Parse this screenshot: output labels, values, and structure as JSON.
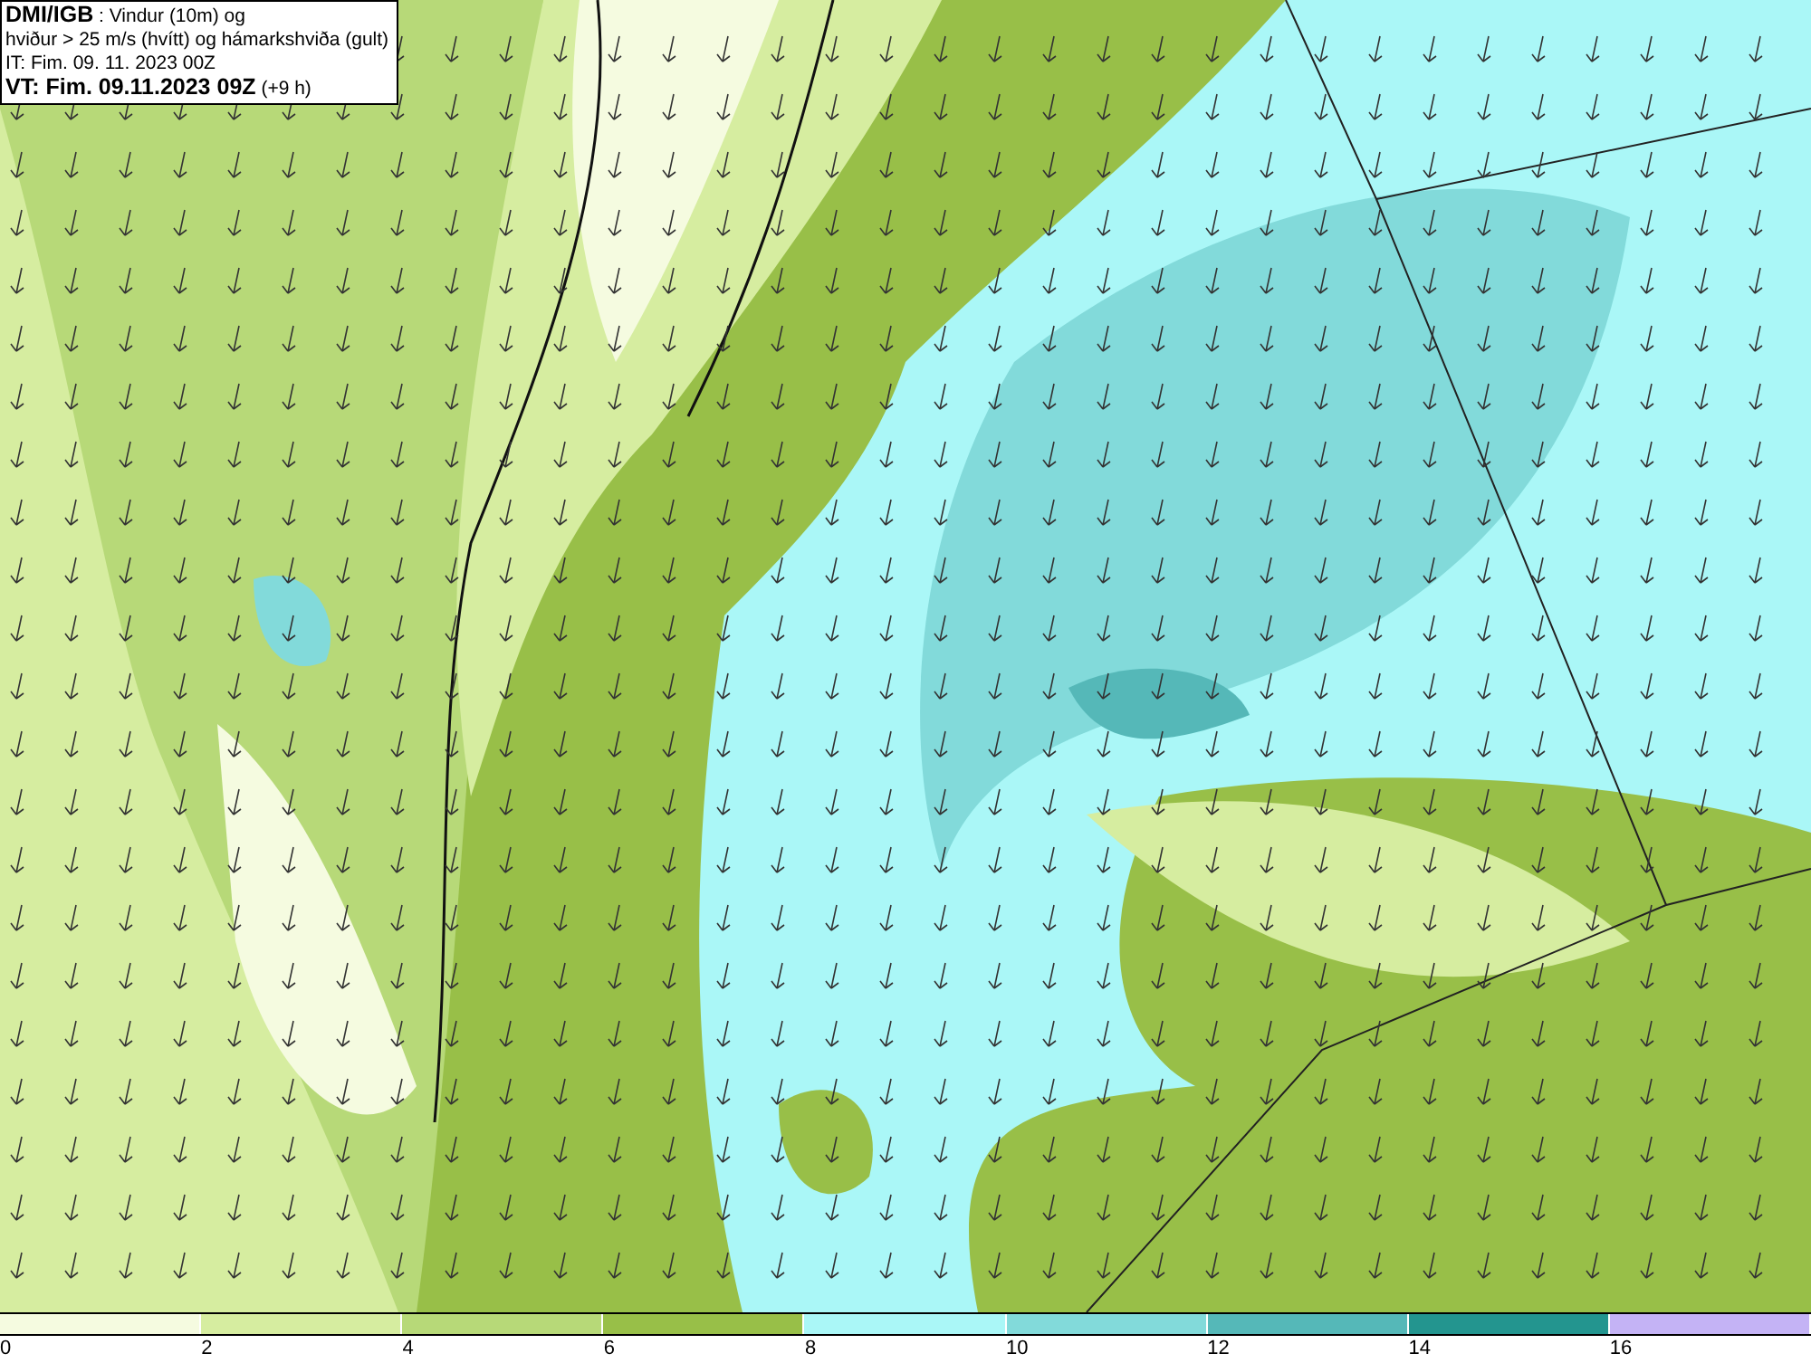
{
  "title_box": {
    "lines": [
      "**DMI/IGB** : Vindur (10m) og",
      "hviður > 25 m/s (hvítt) og hámarkshviða (gult)",
      "IT: Fim. 09. 11. 2023 00Z",
      "**VT: Fim. 09.11.2023 09Z** (+9 h)"
    ]
  },
  "legend": {
    "bins": [
      {
        "color": "#f5fbe0"
      },
      {
        "color": "#d6eda0"
      },
      {
        "color": "#b7d978"
      },
      {
        "color": "#98bf48"
      },
      {
        "color": "#aaf7f7"
      },
      {
        "color": "#82dada"
      },
      {
        "color": "#55b8b8"
      },
      {
        "color": "#23958f"
      },
      {
        "color": "#c4b3f5"
      }
    ],
    "ticks": [
      "0",
      "2",
      "4",
      "6",
      "8",
      "10",
      "12",
      "14",
      "16"
    ]
  }
}
